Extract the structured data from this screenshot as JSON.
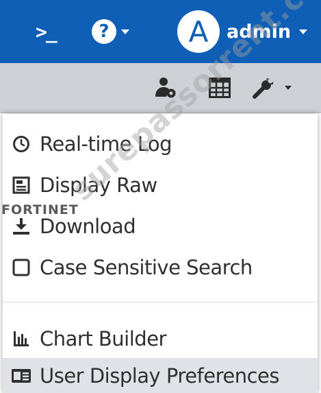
{
  "topbar": {
    "cli_glyph": ">_",
    "help_glyph": "?",
    "avatar_letter": "A",
    "username": "admin"
  },
  "toolbar": {
    "icons": [
      "user-settings-icon",
      "table-icon",
      "wrench-icon"
    ]
  },
  "menu": {
    "items": [
      {
        "label": "Real-time Log",
        "icon": "clock-icon"
      },
      {
        "label": "Display Raw",
        "icon": "raw-view-icon"
      },
      {
        "label": "Download",
        "icon": "download-icon"
      },
      {
        "label": "Case Sensitive Search",
        "icon": "checkbox-icon"
      },
      {
        "label": "Chart Builder",
        "icon": "chart-icon"
      },
      {
        "label": "User Display Preferences",
        "icon": "id-card-icon"
      }
    ]
  },
  "overlay": {
    "brand": "FORTINET",
    "watermark": "surepassorrent.com"
  },
  "colors": {
    "topbar": "#0f5fb6",
    "toolbar": "#cdd1d6",
    "hover_row": "#dfe2e6",
    "brand_red": "#d52b1e"
  }
}
